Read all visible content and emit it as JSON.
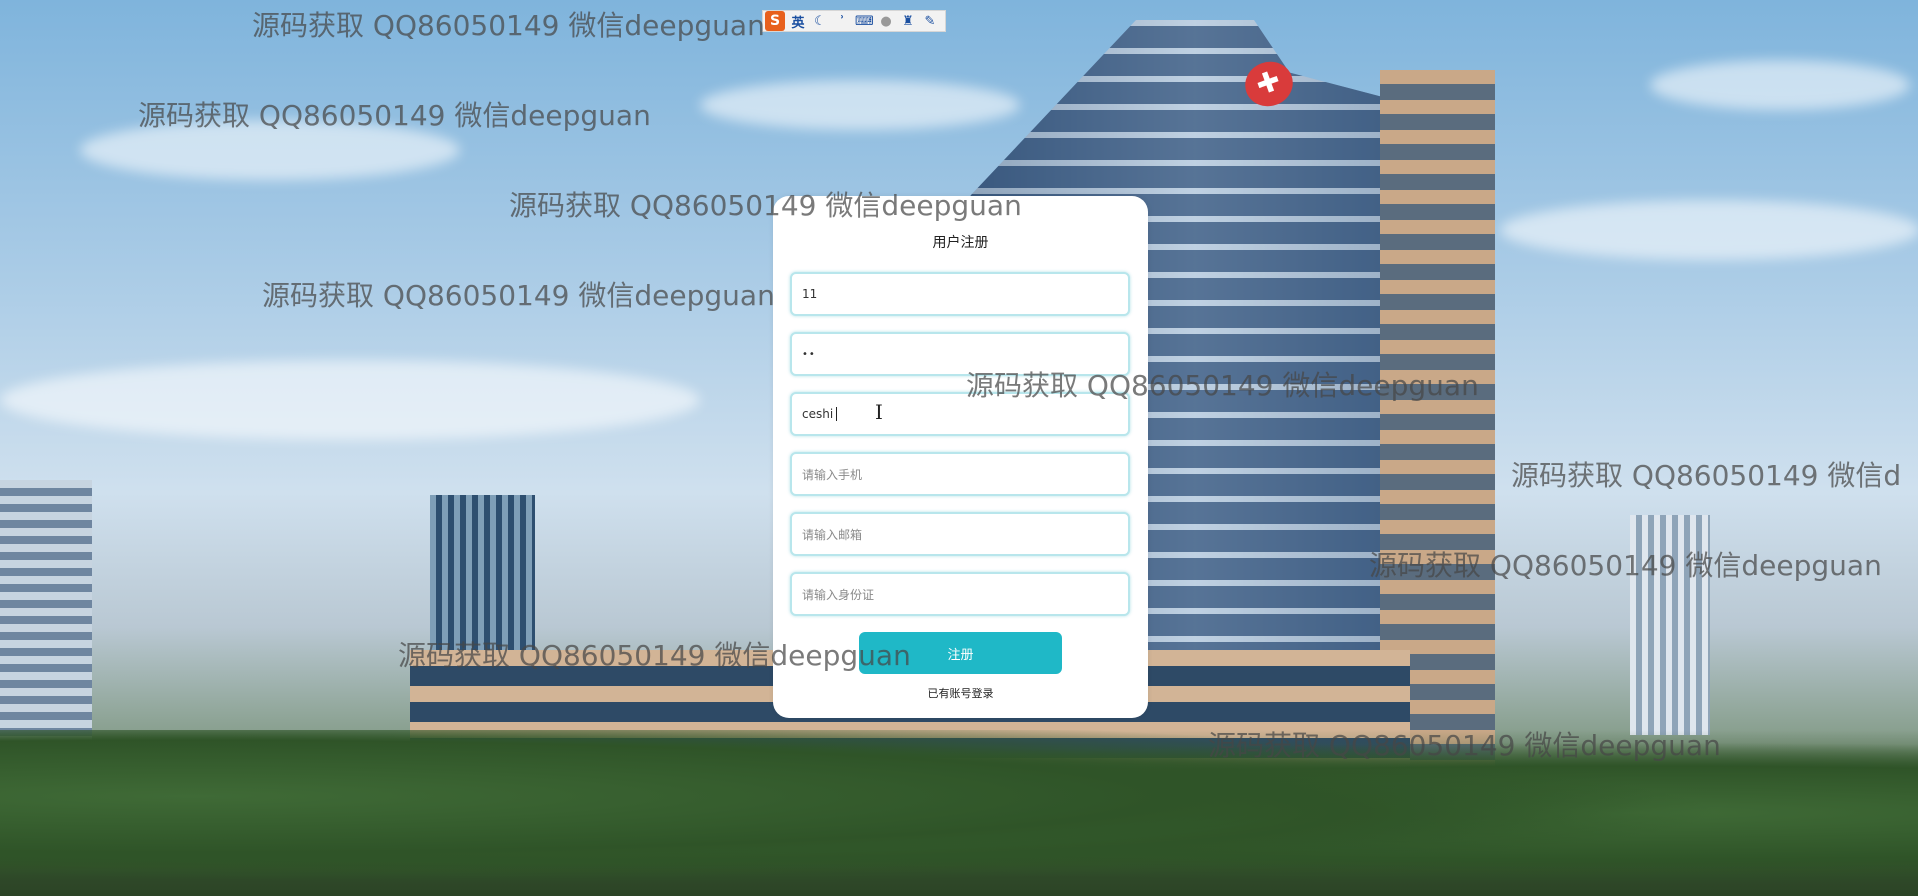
{
  "ime_toolbar": {
    "logo": "S",
    "lang": "英",
    "items": [
      "moon-icon",
      "punct-icon",
      "keyboard-icon",
      "user-icon",
      "shirt-icon",
      "wrench-icon"
    ]
  },
  "register": {
    "title": "用户注册",
    "fields": {
      "account": {
        "value": "11"
      },
      "password": {
        "value": "••"
      },
      "name": {
        "value": "ceshi"
      },
      "phone": {
        "placeholder": "请输入手机"
      },
      "email": {
        "placeholder": "请输入邮箱"
      },
      "id_card": {
        "placeholder": "请输入身份证"
      }
    },
    "submit_label": "注册",
    "login_link": "已有账号登录"
  },
  "watermark": {
    "text": "源码获取 QQ86050149 微信deepguan",
    "text_cut_1": "源码获取 QQ86050149 微信deepguan",
    "text_cut_2": "源码获取 QQ86050149 微信d"
  },
  "colors": {
    "accent": "#1fb8c7",
    "field_border": "#b8e6ec"
  }
}
